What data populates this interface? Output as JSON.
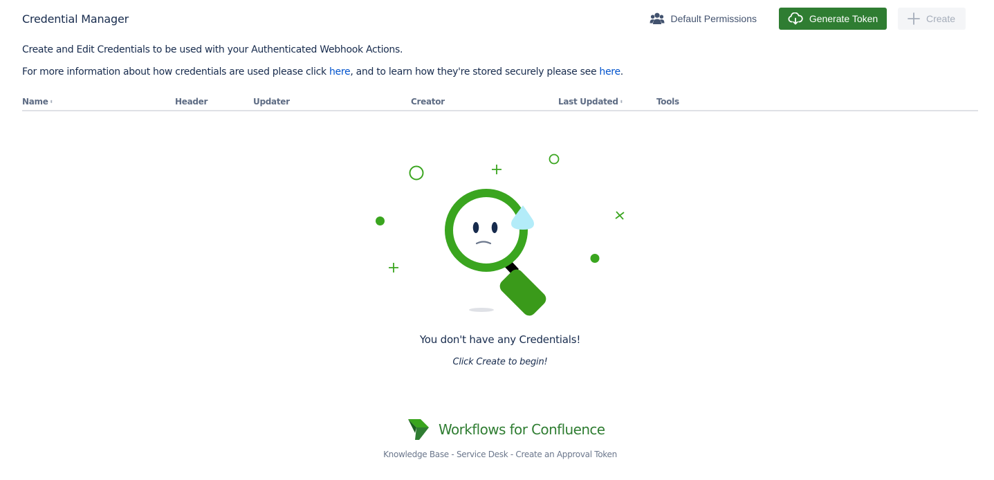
{
  "page": {
    "title": "Credential Manager"
  },
  "toolbar": {
    "default_permissions_label": "Default Permissions",
    "generate_token_label": "Generate Token",
    "create_label": "Create"
  },
  "description": {
    "line1": "Create and Edit Credentials to be used with your Authenticated Webhook Actions.",
    "line2_part1": "For more information about how credentials are used please click ",
    "link1": "here",
    "line2_part2": ", and to learn how they're stored securely please see ",
    "link2": "here",
    "line2_part3": "."
  },
  "table": {
    "columns": [
      {
        "label": "Name",
        "sortable": true
      },
      {
        "label": "Header",
        "sortable": false
      },
      {
        "label": "Updater",
        "sortable": false
      },
      {
        "label": "Creator",
        "sortable": false
      },
      {
        "label": "Last Updated",
        "sortable": true
      },
      {
        "label": "Tools",
        "sortable": false
      }
    ],
    "rows": []
  },
  "empty_state": {
    "title": "You don't have any Credentials!",
    "subtitle": "Click Create to begin!",
    "illustration": "sad-magnifying-glass-icon"
  },
  "footer": {
    "brand": "Workflows for Confluence",
    "links": [
      "Knowledge Base",
      "Service Desk",
      "Create an Approval Token"
    ],
    "separator": " - "
  },
  "colors": {
    "brand_green": "#2f7d32",
    "illustration_green": "#3aa51f",
    "link_blue": "#0052cc",
    "disabled_bg": "#f4f5f7",
    "disabled_text": "#a5adba"
  }
}
